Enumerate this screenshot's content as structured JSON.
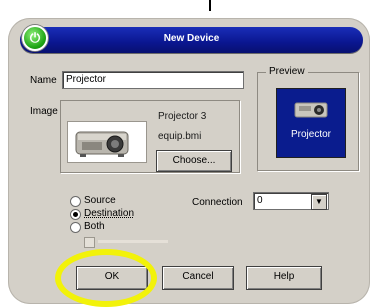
{
  "window": {
    "title": "New Device"
  },
  "form": {
    "name_label": "Name",
    "name_value": "Projector",
    "image_label": "Image",
    "image_name": "Projector 3",
    "image_file": "equip.bmi",
    "choose_label": "Choose..."
  },
  "preview": {
    "label": "Preview",
    "caption": "Projector"
  },
  "type_options": [
    {
      "label": "Source",
      "selected": false
    },
    {
      "label": "Destination",
      "selected": true
    },
    {
      "label": "Both",
      "selected": false
    }
  ],
  "connection": {
    "label": "Connection",
    "value": "0"
  },
  "buttons": {
    "ok": "OK",
    "cancel": "Cancel",
    "help": "Help"
  },
  "colors": {
    "title_bar": "#0a1690",
    "dialog_bg": "#d4d0c8",
    "highlight_ring": "#f2f20a",
    "power_button": "#1ea414"
  }
}
